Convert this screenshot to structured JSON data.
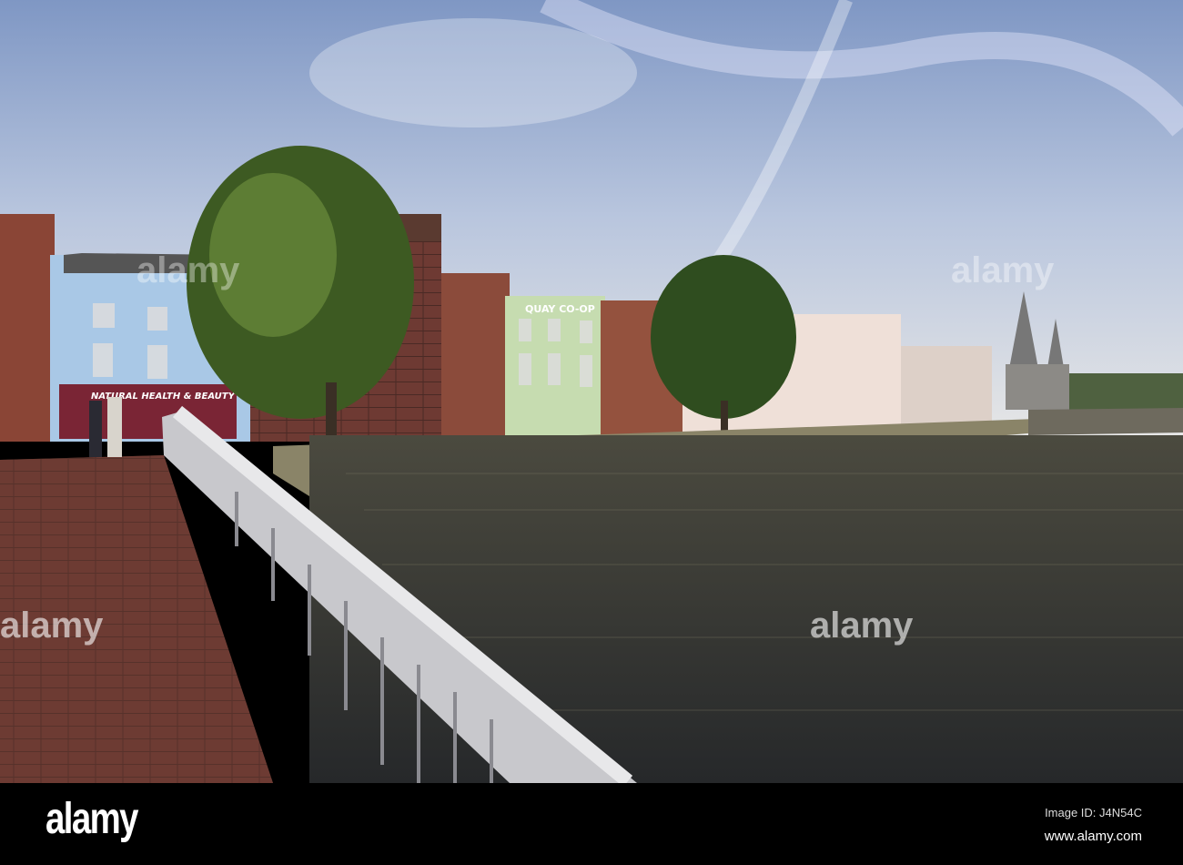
{
  "photo": {
    "shop_signs": [
      "QUAY CO-OP",
      "NATURAL HEALTH & BEAUTY"
    ],
    "watermark": "alamy"
  },
  "footer": {
    "logo": "alamy",
    "image_id": "Image ID: J4N54C",
    "url": "www.alamy.com"
  }
}
